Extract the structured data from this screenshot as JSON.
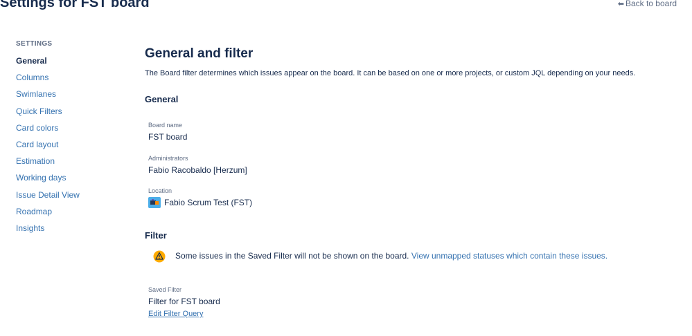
{
  "header": {
    "title": "Settings for FST board",
    "back_link": "Back to board"
  },
  "sidebar": {
    "heading": "SETTINGS",
    "items": [
      {
        "label": "General",
        "active": true
      },
      {
        "label": "Columns"
      },
      {
        "label": "Swimlanes"
      },
      {
        "label": "Quick Filters"
      },
      {
        "label": "Card colors"
      },
      {
        "label": "Card layout"
      },
      {
        "label": "Estimation"
      },
      {
        "label": "Working days"
      },
      {
        "label": "Issue Detail View"
      },
      {
        "label": "Roadmap"
      },
      {
        "label": "Insights"
      }
    ]
  },
  "main": {
    "title": "General and filter",
    "description": "The Board filter determines which issues appear on the board. It can be based on one or more projects, or custom JQL depending on your needs.",
    "general": {
      "heading": "General",
      "board_name_label": "Board name",
      "board_name": "FST board",
      "administrators_label": "Administrators",
      "administrators": "Fabio Racobaldo [Herzum]",
      "location_label": "Location",
      "location": "Fabio Scrum Test (FST)",
      "location_icon": "project-avatar-icon"
    },
    "filter": {
      "heading": "Filter",
      "warning_text": "Some issues in the Saved Filter will not be shown on the board.",
      "warning_link": "View unmapped statuses which contain these issues.",
      "warning_icon": "warning-icon",
      "saved_filter_label": "Saved Filter",
      "saved_filter": "Filter for FST board",
      "edit_link": "Edit Filter Query"
    }
  },
  "colors": {
    "link": "#3572b0",
    "text": "#172b4d",
    "muted": "#5e6c84",
    "warning": "#ffab00"
  }
}
